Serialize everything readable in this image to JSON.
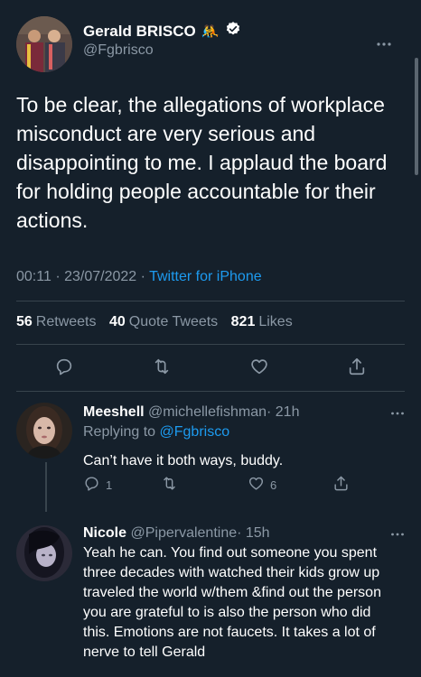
{
  "tweet": {
    "author_name": "Gerald BRISCO",
    "author_emoji": "🤼",
    "handle": "@Fgbrisco",
    "text": "To be clear, the allegations of workplace misconduct are very serious and disappointing to me. I applaud the board for holding people accountable for their actions.",
    "time": "00:11",
    "separator": "·",
    "date": "23/07/2022",
    "source": "Twitter for iPhone",
    "stats": {
      "retweets_count": "56",
      "retweets_label": "Retweets",
      "quotes_count": "40",
      "quotes_label": "Quote Tweets",
      "likes_count": "821",
      "likes_label": "Likes"
    }
  },
  "replies": [
    {
      "name": "Meeshell",
      "handle": "@michellefishman",
      "age": "· 21h",
      "replying_prefix": "Replying to",
      "replying_to": "@Fgbrisco",
      "text": "Can’t have it both ways, buddy.",
      "reply_count": "1",
      "retweet_count": "",
      "like_count": "6"
    },
    {
      "name": "Nicole",
      "handle": "@Pipervalentine",
      "age": "· 15h",
      "text": "Yeah he can.  You find out someone you spent three decades with watched their kids grow up traveled the world w/them &find out the person you are grateful to is also the person who did this.  Emotions are not faucets. It takes a lot of nerve to tell Gerald"
    }
  ],
  "colors": {
    "background": "#15202b",
    "text": "#ffffff",
    "secondary": "#8b98a5",
    "accent": "#1d9bf0",
    "divider": "#38444d"
  },
  "icons": [
    "more-icon",
    "verified-icon",
    "reply-icon",
    "retweet-icon",
    "like-icon",
    "share-icon"
  ]
}
